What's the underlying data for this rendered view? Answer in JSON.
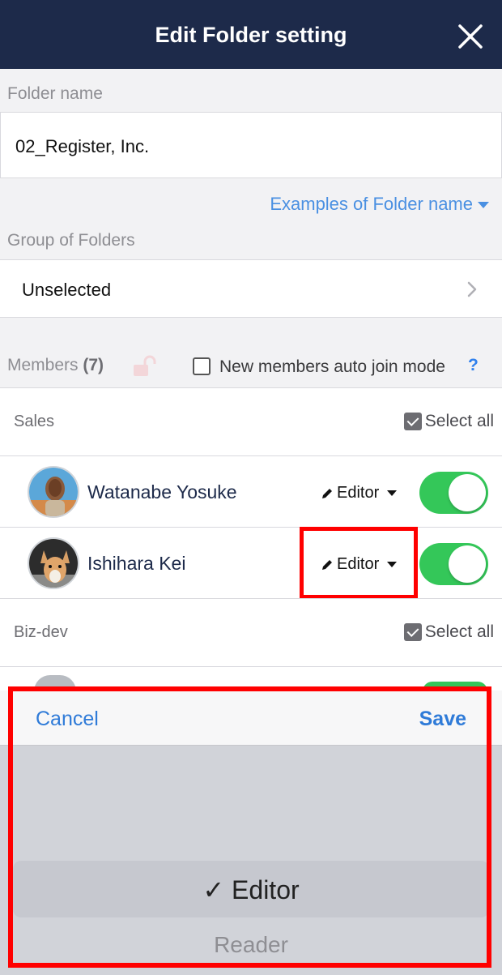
{
  "header": {
    "title": "Edit Folder setting",
    "close_icon": "close-icon"
  },
  "folder_name": {
    "label": "Folder name",
    "value": "02_Register, Inc."
  },
  "examples_link": "Examples of Folder name",
  "group": {
    "label": "Group of Folders",
    "value": "Unselected"
  },
  "members": {
    "label": "Members",
    "count": "(7)",
    "auto_join_label": "New members auto join mode",
    "help": "?"
  },
  "sections": [
    {
      "name": "Sales",
      "select_all": "Select all",
      "members": [
        {
          "name": "Watanabe Yosuke",
          "role": "Editor",
          "enabled": true
        },
        {
          "name": "Ishihara Kei",
          "role": "Editor",
          "enabled": true
        }
      ]
    },
    {
      "name": "Biz-dev",
      "select_all": "Select all",
      "members": []
    }
  ],
  "picker": {
    "cancel": "Cancel",
    "save": "Save",
    "options": [
      "✓ Editor",
      "Reader"
    ],
    "selected": "Editor"
  },
  "colors": {
    "header": "#1d2a4a",
    "link": "#4a90e2",
    "toggle_on": "#34c759",
    "highlight": "#ff0000"
  }
}
